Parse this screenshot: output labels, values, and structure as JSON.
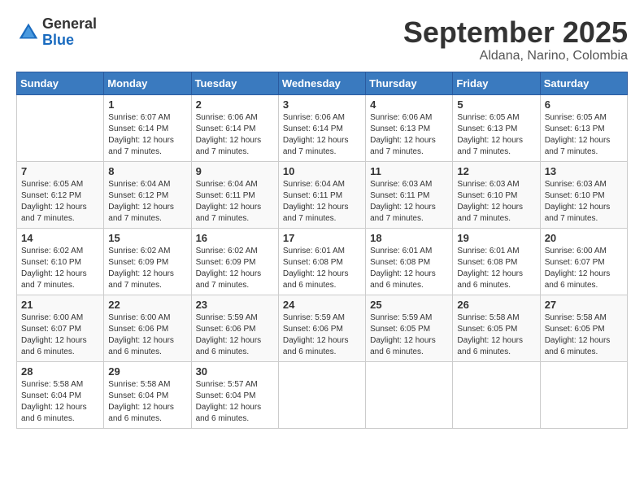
{
  "logo": {
    "general": "General",
    "blue": "Blue"
  },
  "title": {
    "month_year": "September 2025",
    "location": "Aldana, Narino, Colombia"
  },
  "calendar": {
    "headers": [
      "Sunday",
      "Monday",
      "Tuesday",
      "Wednesday",
      "Thursday",
      "Friday",
      "Saturday"
    ],
    "weeks": [
      [
        {
          "day": "",
          "info": ""
        },
        {
          "day": "1",
          "info": "Sunrise: 6:07 AM\nSunset: 6:14 PM\nDaylight: 12 hours\nand 7 minutes."
        },
        {
          "day": "2",
          "info": "Sunrise: 6:06 AM\nSunset: 6:14 PM\nDaylight: 12 hours\nand 7 minutes."
        },
        {
          "day": "3",
          "info": "Sunrise: 6:06 AM\nSunset: 6:14 PM\nDaylight: 12 hours\nand 7 minutes."
        },
        {
          "day": "4",
          "info": "Sunrise: 6:06 AM\nSunset: 6:13 PM\nDaylight: 12 hours\nand 7 minutes."
        },
        {
          "day": "5",
          "info": "Sunrise: 6:05 AM\nSunset: 6:13 PM\nDaylight: 12 hours\nand 7 minutes."
        },
        {
          "day": "6",
          "info": "Sunrise: 6:05 AM\nSunset: 6:13 PM\nDaylight: 12 hours\nand 7 minutes."
        }
      ],
      [
        {
          "day": "7",
          "info": "Sunrise: 6:05 AM\nSunset: 6:12 PM\nDaylight: 12 hours\nand 7 minutes."
        },
        {
          "day": "8",
          "info": "Sunrise: 6:04 AM\nSunset: 6:12 PM\nDaylight: 12 hours\nand 7 minutes."
        },
        {
          "day": "9",
          "info": "Sunrise: 6:04 AM\nSunset: 6:11 PM\nDaylight: 12 hours\nand 7 minutes."
        },
        {
          "day": "10",
          "info": "Sunrise: 6:04 AM\nSunset: 6:11 PM\nDaylight: 12 hours\nand 7 minutes."
        },
        {
          "day": "11",
          "info": "Sunrise: 6:03 AM\nSunset: 6:11 PM\nDaylight: 12 hours\nand 7 minutes."
        },
        {
          "day": "12",
          "info": "Sunrise: 6:03 AM\nSunset: 6:10 PM\nDaylight: 12 hours\nand 7 minutes."
        },
        {
          "day": "13",
          "info": "Sunrise: 6:03 AM\nSunset: 6:10 PM\nDaylight: 12 hours\nand 7 minutes."
        }
      ],
      [
        {
          "day": "14",
          "info": "Sunrise: 6:02 AM\nSunset: 6:10 PM\nDaylight: 12 hours\nand 7 minutes."
        },
        {
          "day": "15",
          "info": "Sunrise: 6:02 AM\nSunset: 6:09 PM\nDaylight: 12 hours\nand 7 minutes."
        },
        {
          "day": "16",
          "info": "Sunrise: 6:02 AM\nSunset: 6:09 PM\nDaylight: 12 hours\nand 7 minutes."
        },
        {
          "day": "17",
          "info": "Sunrise: 6:01 AM\nSunset: 6:08 PM\nDaylight: 12 hours\nand 6 minutes."
        },
        {
          "day": "18",
          "info": "Sunrise: 6:01 AM\nSunset: 6:08 PM\nDaylight: 12 hours\nand 6 minutes."
        },
        {
          "day": "19",
          "info": "Sunrise: 6:01 AM\nSunset: 6:08 PM\nDaylight: 12 hours\nand 6 minutes."
        },
        {
          "day": "20",
          "info": "Sunrise: 6:00 AM\nSunset: 6:07 PM\nDaylight: 12 hours\nand 6 minutes."
        }
      ],
      [
        {
          "day": "21",
          "info": "Sunrise: 6:00 AM\nSunset: 6:07 PM\nDaylight: 12 hours\nand 6 minutes."
        },
        {
          "day": "22",
          "info": "Sunrise: 6:00 AM\nSunset: 6:06 PM\nDaylight: 12 hours\nand 6 minutes."
        },
        {
          "day": "23",
          "info": "Sunrise: 5:59 AM\nSunset: 6:06 PM\nDaylight: 12 hours\nand 6 minutes."
        },
        {
          "day": "24",
          "info": "Sunrise: 5:59 AM\nSunset: 6:06 PM\nDaylight: 12 hours\nand 6 minutes."
        },
        {
          "day": "25",
          "info": "Sunrise: 5:59 AM\nSunset: 6:05 PM\nDaylight: 12 hours\nand 6 minutes."
        },
        {
          "day": "26",
          "info": "Sunrise: 5:58 AM\nSunset: 6:05 PM\nDaylight: 12 hours\nand 6 minutes."
        },
        {
          "day": "27",
          "info": "Sunrise: 5:58 AM\nSunset: 6:05 PM\nDaylight: 12 hours\nand 6 minutes."
        }
      ],
      [
        {
          "day": "28",
          "info": "Sunrise: 5:58 AM\nSunset: 6:04 PM\nDaylight: 12 hours\nand 6 minutes."
        },
        {
          "day": "29",
          "info": "Sunrise: 5:58 AM\nSunset: 6:04 PM\nDaylight: 12 hours\nand 6 minutes."
        },
        {
          "day": "30",
          "info": "Sunrise: 5:57 AM\nSunset: 6:04 PM\nDaylight: 12 hours\nand 6 minutes."
        },
        {
          "day": "",
          "info": ""
        },
        {
          "day": "",
          "info": ""
        },
        {
          "day": "",
          "info": ""
        },
        {
          "day": "",
          "info": ""
        }
      ]
    ]
  }
}
